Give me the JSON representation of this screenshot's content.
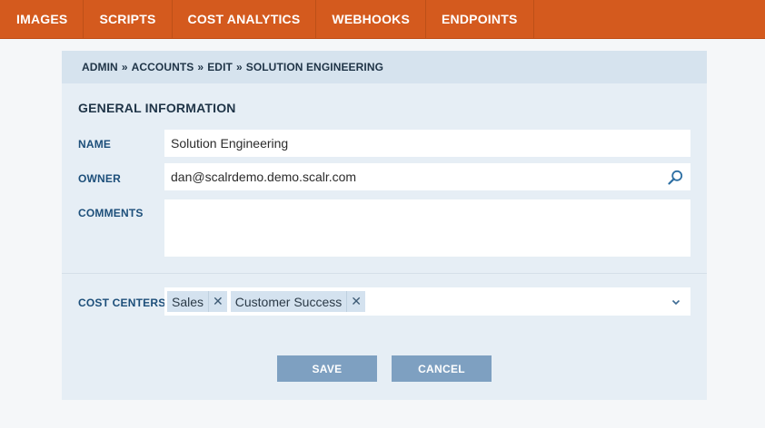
{
  "nav": {
    "items": [
      "IMAGES",
      "SCRIPTS",
      "COST ANALYTICS",
      "WEBHOOKS",
      "ENDPOINTS"
    ]
  },
  "breadcrumb": {
    "items": [
      "ADMIN",
      "ACCOUNTS",
      "EDIT"
    ],
    "separator": "»",
    "current": "SOLUTION ENGINEERING"
  },
  "form": {
    "section_title": "GENERAL INFORMATION",
    "name": {
      "label": "NAME",
      "value": "Solution Engineering"
    },
    "owner": {
      "label": "OWNER",
      "value": "dan@scalrdemo.demo.scalr.com",
      "icon": "search-icon"
    },
    "comments": {
      "label": "COMMENTS",
      "value": ""
    },
    "cost_centers": {
      "label": "COST CENTERS",
      "tags": [
        "Sales",
        "Customer Success"
      ],
      "remove_symbol": "✕",
      "icon": "chevron-down-icon"
    }
  },
  "buttons": {
    "save": "SAVE",
    "cancel": "CANCEL"
  },
  "colors": {
    "nav_bg": "#d45a1e",
    "panel_bg": "#e6eef5",
    "breadcrumb_bg": "#d6e3ee",
    "label": "#1d4f7a",
    "button_bg": "#7ea0c1",
    "tag_bg": "#d4e2ef"
  }
}
